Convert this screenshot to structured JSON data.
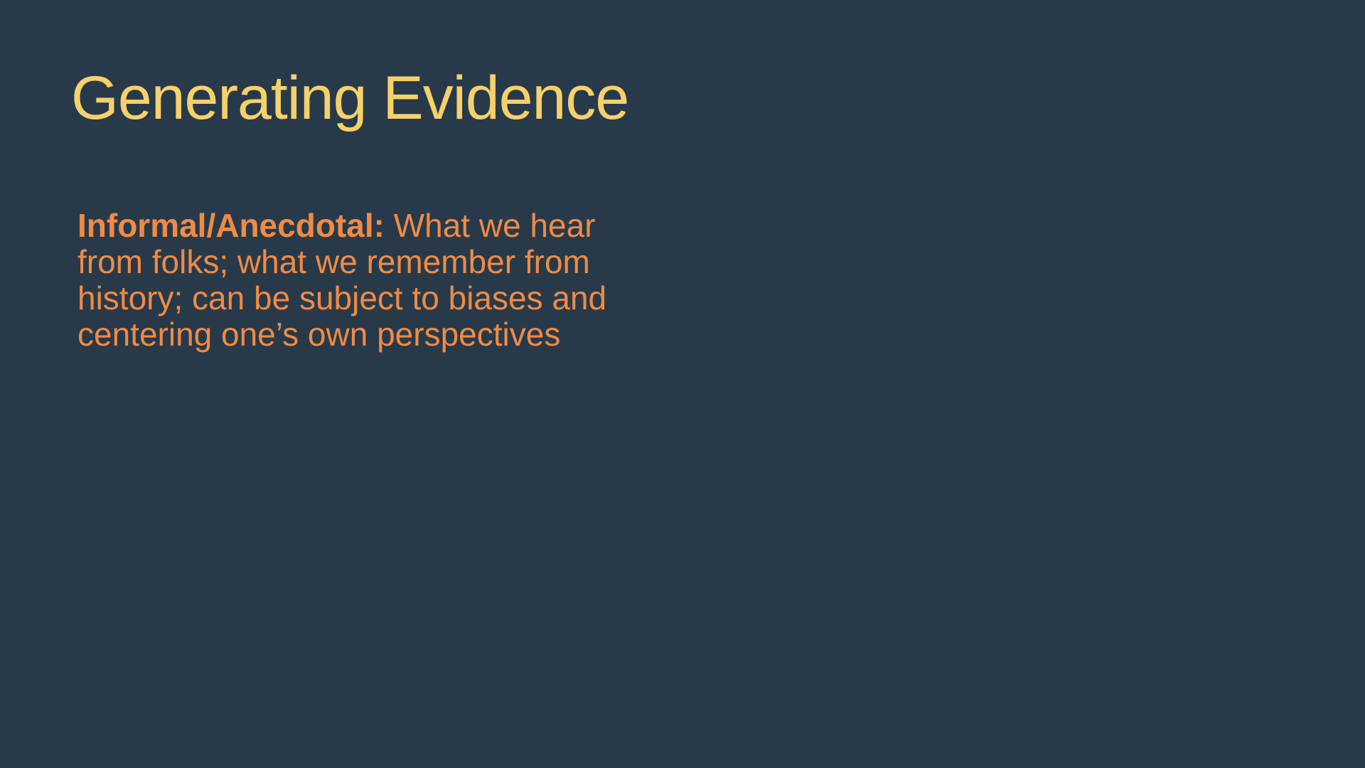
{
  "slide": {
    "title": "Generating Evidence",
    "paragraph": {
      "term": "Informal/Anecdotal:",
      "description": " What we hear from folks; what we remember from history; can be subject to biases and centering one’s own perspectives"
    }
  },
  "colors": {
    "background": "#283a4a",
    "title": "#f6d16b",
    "body": "#ef8b46"
  }
}
